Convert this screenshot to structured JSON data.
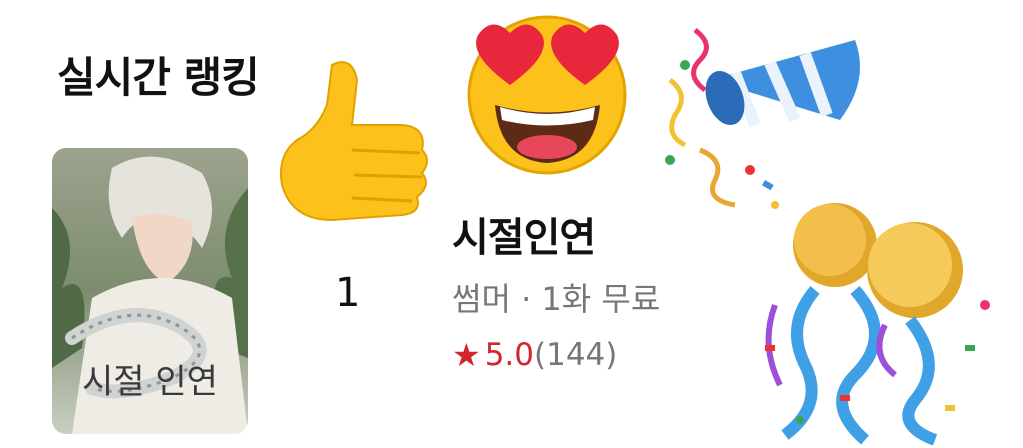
{
  "section": {
    "title": "실시간 랭킹"
  },
  "item": {
    "rank": "1",
    "title": "시절인연",
    "author": "썸머",
    "free_episodes": "1화 무료",
    "separator": " · ",
    "rating": "5.0",
    "review_count": "(144)",
    "cover_text": "시절 인연"
  },
  "colors": {
    "rating": "#d2262b",
    "meta": "#777777"
  },
  "decorations": [
    "thumbs-up-icon",
    "heart-eyes-icon",
    "party-popper-icon",
    "confetti-balls-icon"
  ]
}
